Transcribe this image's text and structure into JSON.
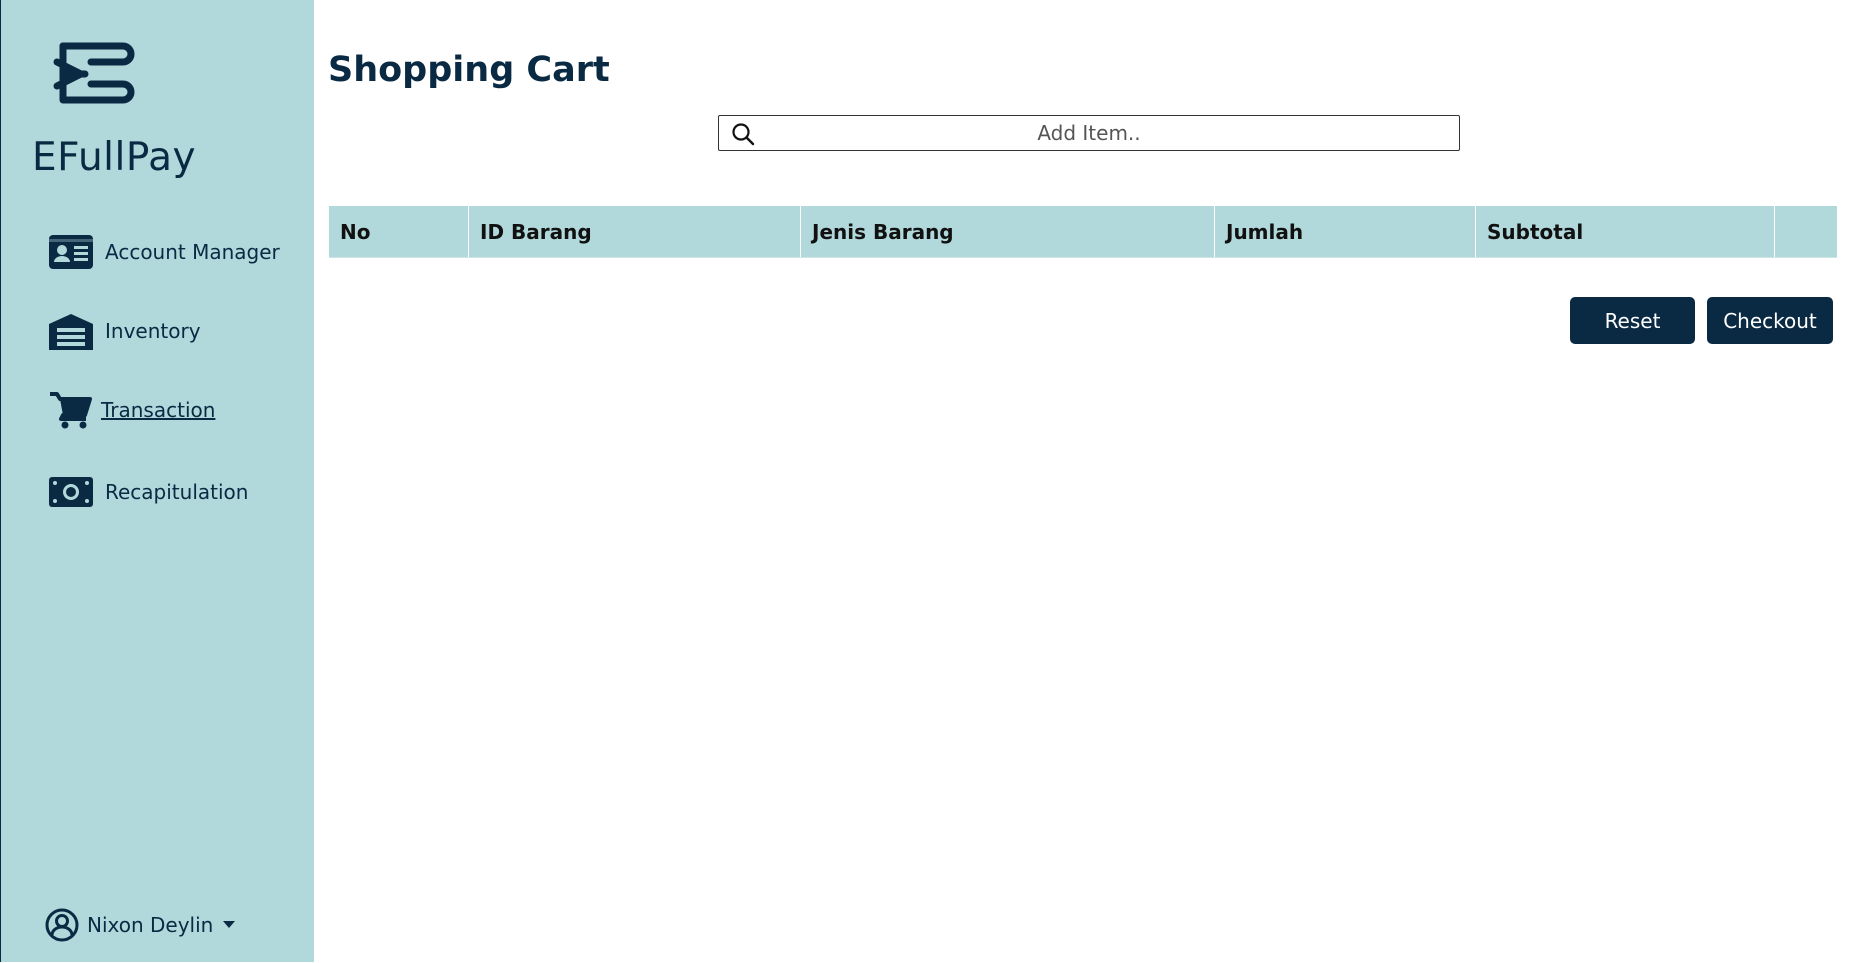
{
  "sidebar": {
    "brand": "EFullPay",
    "logo_icon": "efullpay-logo",
    "items": [
      {
        "label": "Account Manager",
        "icon": "id-card-icon",
        "active": false
      },
      {
        "label": "Inventory",
        "icon": "warehouse-icon",
        "active": false
      },
      {
        "label": "Transaction",
        "icon": "cart-icon",
        "active": true
      },
      {
        "label": "Recapitulation",
        "icon": "money-icon",
        "active": false
      }
    ],
    "user": {
      "name": "Nixon Deylin",
      "icon": "user-circle-icon"
    }
  },
  "main": {
    "title": "Shopping Cart",
    "search": {
      "placeholder": "Add Item..",
      "value": ""
    },
    "table": {
      "columns": [
        "No",
        "ID Barang",
        "Jenis Barang",
        "Jumlah",
        "Subtotal",
        ""
      ],
      "rows": []
    },
    "buttons": {
      "reset": "Reset",
      "checkout": "Checkout"
    }
  },
  "colors": {
    "sidebar_bg": "#b1d8da",
    "primary": "#0a2a44",
    "table_header_bg": "#b1d8da"
  }
}
